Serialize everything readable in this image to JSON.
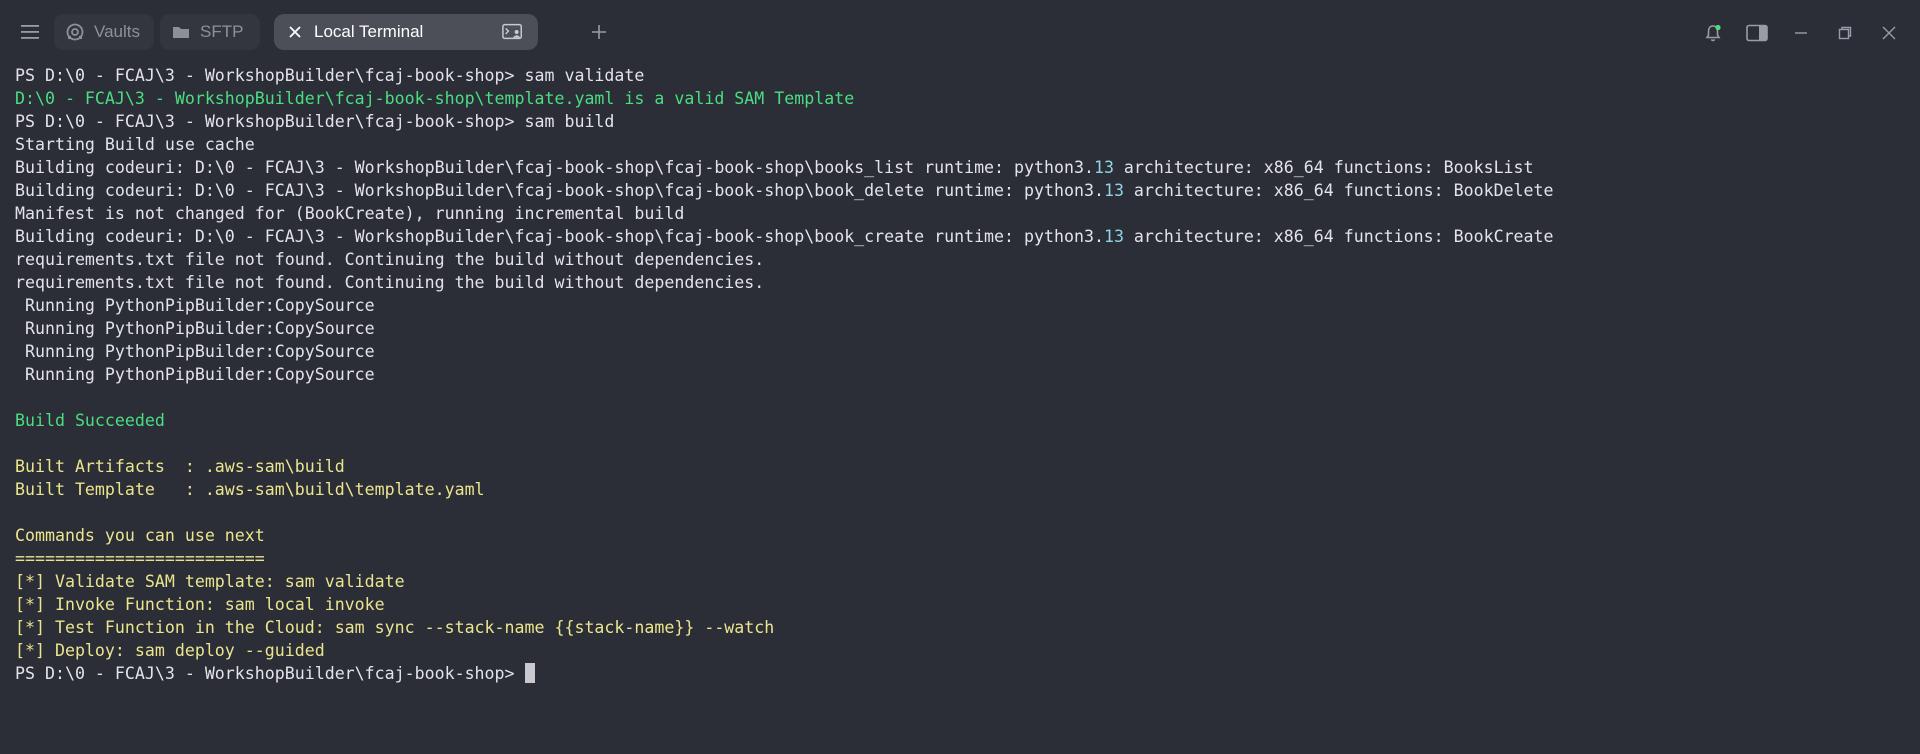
{
  "tabs": {
    "vaults": "Vaults",
    "sftp": "SFTP",
    "local_terminal": "Local Terminal"
  },
  "colors": {
    "background": "#2b2d37",
    "active_tab": "#4c4e58",
    "success_green": "#4ade80",
    "info_yellow": "#ebe58e",
    "number_cyan": "#8fd5e6",
    "notification_dot": "#4ade80"
  },
  "icons": [
    "menu-icon",
    "vaults-icon",
    "folder-icon",
    "close-icon",
    "terminal-user-icon",
    "plus-icon",
    "bell-icon",
    "sidebar-panel-icon",
    "minimize-icon",
    "restore-icon",
    "close-window-icon"
  ],
  "terminal": {
    "l0": "PS D:\\0 - FCAJ\\3 - WorkshopBuilder\\fcaj-book-shop> sam validate",
    "l1": "D:\\0 - FCAJ\\3 - WorkshopBuilder\\fcaj-book-shop\\template.yaml is a valid SAM Template",
    "l2": "PS D:\\0 - FCAJ\\3 - WorkshopBuilder\\fcaj-book-shop> sam build",
    "l3": "Starting Build use cache",
    "l4a": "Building codeuri: D:\\0 - FCAJ\\3 - WorkshopBuilder\\fcaj-book-shop\\fcaj-book-shop\\books_list runtime: python3.",
    "l4num": "13",
    "l4b": " architecture: x86_64 functions: BooksList",
    "l5a": "Building codeuri: D:\\0 - FCAJ\\3 - WorkshopBuilder\\fcaj-book-shop\\fcaj-book-shop\\book_delete runtime: python3.",
    "l5num": "13",
    "l5b": " architecture: x86_64 functions: BookDelete",
    "l6": "Manifest is not changed for (BookCreate), running incremental build",
    "l7a": "Building codeuri: D:\\0 - FCAJ\\3 - WorkshopBuilder\\fcaj-book-shop\\fcaj-book-shop\\book_create runtime: python3.",
    "l7num": "13",
    "l7b": " architecture: x86_64 functions: BookCreate",
    "l8": "requirements.txt file not found. Continuing the build without dependencies.",
    "l9": "requirements.txt file not found. Continuing the build without dependencies.",
    "l10": " Running PythonPipBuilder:CopySource",
    "l11": " Running PythonPipBuilder:CopySource",
    "l12": " Running PythonPipBuilder:CopySource",
    "l13": " Running PythonPipBuilder:CopySource",
    "l15": "Build Succeeded",
    "l17": "Built Artifacts  : .aws-sam\\build",
    "l18": "Built Template   : .aws-sam\\build\\template.yaml",
    "l20": "Commands you can use next",
    "l21": "=========================",
    "l22": "[*] Validate SAM template: sam validate",
    "l23": "[*] Invoke Function: sam local invoke",
    "l24": "[*] Test Function in the Cloud: sam sync --stack-name {{stack-name}} --watch",
    "l25": "[*] Deploy: sam deploy --guided",
    "l26": "PS D:\\0 - FCAJ\\3 - WorkshopBuilder\\fcaj-book-shop>"
  }
}
